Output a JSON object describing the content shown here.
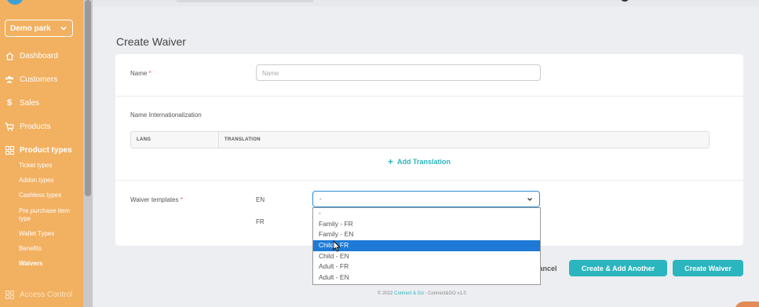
{
  "sidebar": {
    "park": "Demo park",
    "nav": [
      {
        "label": "Dashboard",
        "icon": "home-icon"
      },
      {
        "label": "Customers",
        "icon": "users-icon"
      },
      {
        "label": "Sales",
        "icon": "dollar-icon"
      },
      {
        "label": "Products",
        "icon": "cart-icon"
      },
      {
        "label": "Product types",
        "icon": "grid-icon"
      }
    ],
    "sub": [
      "Ticket types",
      "Addon types",
      "Cashless types",
      "Pre purchase item type",
      "Wallet Types",
      "Benefits",
      "Waivers"
    ],
    "access_control": "Access Control"
  },
  "page": {
    "title": "Create Waiver"
  },
  "form": {
    "name_label": "Name",
    "required_mark": "*",
    "name_placeholder": "Name",
    "intl_label": "Name Internationalization",
    "col_lang": "LANG",
    "col_translation": "TRANSLATION",
    "add_translation": "Add Translation",
    "templates_label": "Waiver templates",
    "lang_en": "EN",
    "lang_fr": "FR",
    "select_value": "-"
  },
  "dropdown": {
    "options": [
      "-",
      "Family - FR",
      "Family - EN",
      "Child - FR",
      "Child - EN",
      "Adult - FR",
      "Adult - EN"
    ],
    "selected_index": 3
  },
  "actions": {
    "cancel": "Cancel",
    "create_add_another": "Create & Add Another",
    "create_waiver": "Create Waiver"
  },
  "footer": {
    "prefix": "© 2022",
    "brand": "Connect & Go",
    "sep": "-",
    "version": "Connect&GO v1.0"
  },
  "colors": {
    "sidebar": "#f2b061",
    "accent": "#2bb5be",
    "selection": "#1e7ad6"
  }
}
